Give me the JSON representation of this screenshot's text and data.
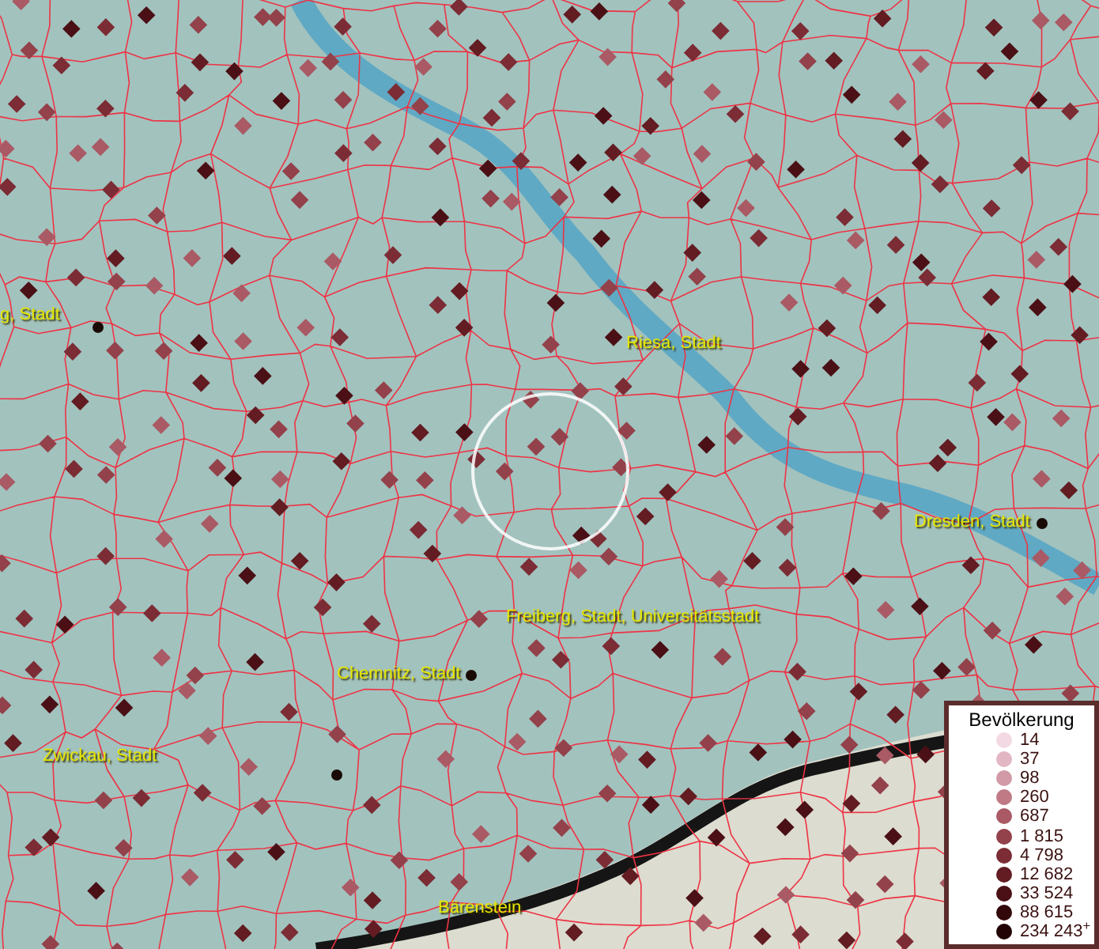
{
  "map": {
    "place_labels": [
      "g, Stadt",
      "Riesa, Stadt",
      "Dresden, Stadt",
      "Freiberg, Stadt, Universitätsstadt",
      "Chemnitz, Stadt",
      "Zwickau, Stadt",
      "Bärenstein"
    ]
  },
  "legend": {
    "title": "Bevölkerung",
    "items": [
      {
        "label": "14",
        "color": "#f2d9e4"
      },
      {
        "label": "37",
        "color": "#e3b6c4"
      },
      {
        "label": "98",
        "color": "#d29aa6"
      },
      {
        "label": "260",
        "color": "#c07a86"
      },
      {
        "label": "687",
        "color": "#a95a64"
      },
      {
        "label": "1 815",
        "color": "#93414a"
      },
      {
        "label": "4 798",
        "color": "#7b2c34"
      },
      {
        "label": "12 682",
        "color": "#621c22"
      },
      {
        "label": "33 524",
        "color": "#4a1015"
      },
      {
        "label": "88 615",
        "color": "#33080b"
      },
      {
        "label": "234 243$^{+}$",
        "color": "#210305"
      }
    ]
  }
}
